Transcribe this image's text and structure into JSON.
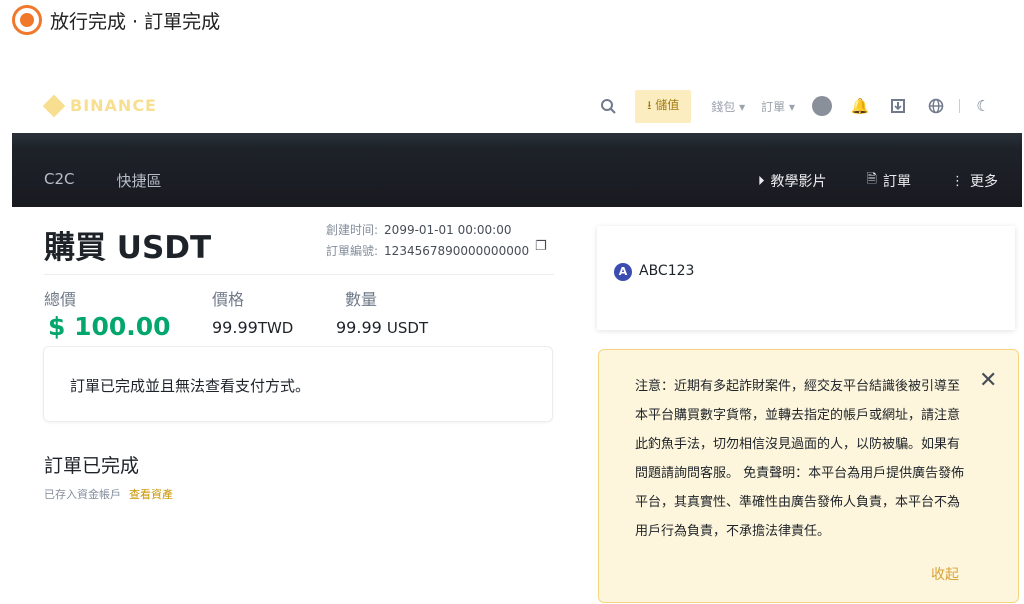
{
  "step": {
    "caption": "放行完成 · 訂單完成"
  },
  "header": {
    "logo_text": "BINANCE",
    "deposit_label": "儲值",
    "wallet_label": "錢包",
    "orders_label": "訂單"
  },
  "nav": {
    "c2c": "C2C",
    "express": "快捷區",
    "tutorial": "教學影片",
    "orders": "訂單",
    "more": "更多"
  },
  "order": {
    "title": "購買 USDT",
    "created_label": "創建时间:",
    "created_value": "2099-01-01 00:00:00",
    "number_label": "訂單編號:",
    "number_value": "1234567890000000000",
    "total_label": "總價",
    "total_value": "$ 100.00",
    "price_label": "價格",
    "price_value": "99.99",
    "price_unit": "TWD",
    "qty_label": "數量",
    "qty_value": "99.99",
    "qty_unit": "USDT",
    "notice": "訂單已完成並且無法查看支付方式。",
    "status_title": "訂單已完成",
    "status_sub": "已存入資金帳戶",
    "view_assets": "查看資產"
  },
  "merchant": {
    "initial": "A",
    "name": "ABC123"
  },
  "warning": {
    "text": "注意：近期有多起詐財案件，經交友平台結識後被引導至本平台購買數字貨幣，並轉去指定的帳戶或網址，請注意此釣魚手法，切勿相信沒見過面的人，以防被騙。如果有問題請詢問客服。 免責聲明：本平台為用戶提供廣告發佈平台，其真實性、準確性由廣告發佈人負責，本平台不為用戶行為負責，不承擔法律責任。",
    "collapse": "收起"
  },
  "colors": {
    "accent": "#f0b90b",
    "success": "#03a66d",
    "step_orange": "#f0782d",
    "warning_bg": "#fdf6dc"
  }
}
